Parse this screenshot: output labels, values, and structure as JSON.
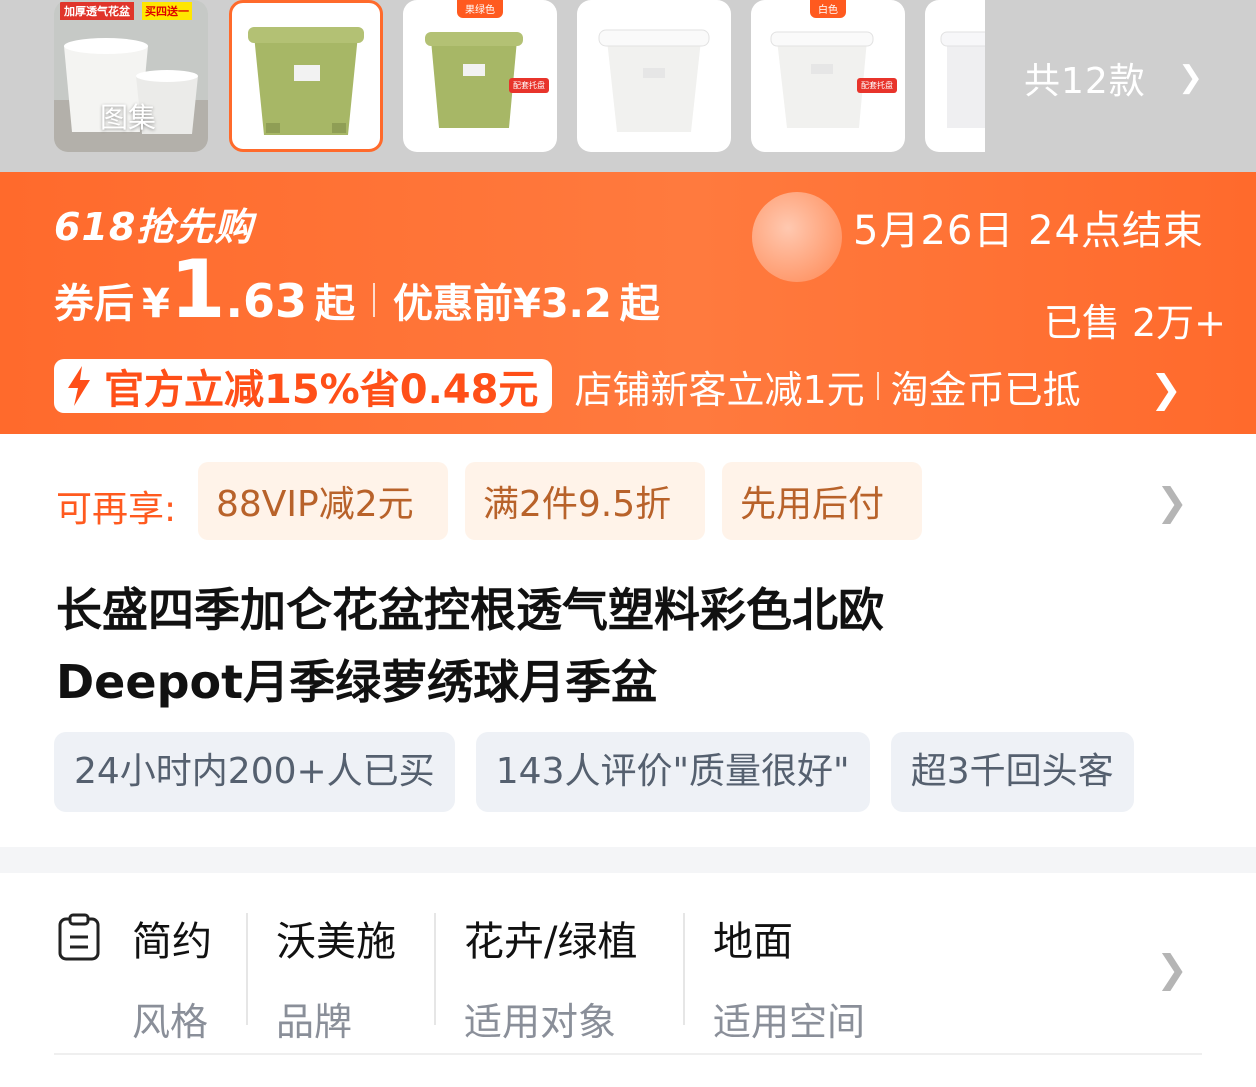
{
  "gallery": {
    "thumbs": [
      {
        "promo": "加厚透气花盆",
        "promo2": "买四送一",
        "label": "图集"
      },
      {
        "tag": ""
      },
      {
        "tag": "果绿色",
        "badge": "配套托盘"
      },
      {
        "tag": ""
      },
      {
        "tag": "白色",
        "badge": "配套托盘"
      },
      {
        "tag": ""
      }
    ],
    "styles_count": "共12款"
  },
  "promo": {
    "event_logo": "618抢先购",
    "event_end": "5月26日 24点结束",
    "after_label": "券后",
    "currency": "¥",
    "price_int": "1",
    "price_dec": ".63",
    "price_suffix": "起",
    "before_label": "优惠前",
    "before_price": "¥3.2",
    "before_suffix": "起",
    "sold": "已售 2万+",
    "official_discount": "官方立减15%省0.48元",
    "shop_new": "店铺新客立减1元",
    "coin": "淘金币已抵"
  },
  "extra": {
    "label": "可再享:",
    "chips": [
      "88VIP减2元",
      "满2件9.5折",
      "先用后付"
    ]
  },
  "product": {
    "title_line1": "长盛四季加仑花盆控根透气塑料彩色北欧",
    "title_line2": "Deepot月季绿萝绣球月季盆",
    "trust": [
      "24小时内200+人已买",
      "143人评价\"质量很好\"",
      "超3千回头客"
    ]
  },
  "attributes": [
    {
      "value": "简约",
      "key": "风格"
    },
    {
      "value": "沃美施",
      "key": "品牌"
    },
    {
      "value": "花卉/绿植",
      "key": "适用对象"
    },
    {
      "value": "地面",
      "key": "适用空间"
    }
  ],
  "colors": {
    "accent": "#ff6a2c",
    "discount_text": "#ff4f18",
    "chip_bg": "#fff3e9",
    "chip_text": "#b8622a",
    "pot_green": "#a7b766",
    "pot_white": "#f5f5f3"
  },
  "icons": [
    "chevron-right-icon",
    "lightning-icon",
    "clipboard-icon"
  ]
}
